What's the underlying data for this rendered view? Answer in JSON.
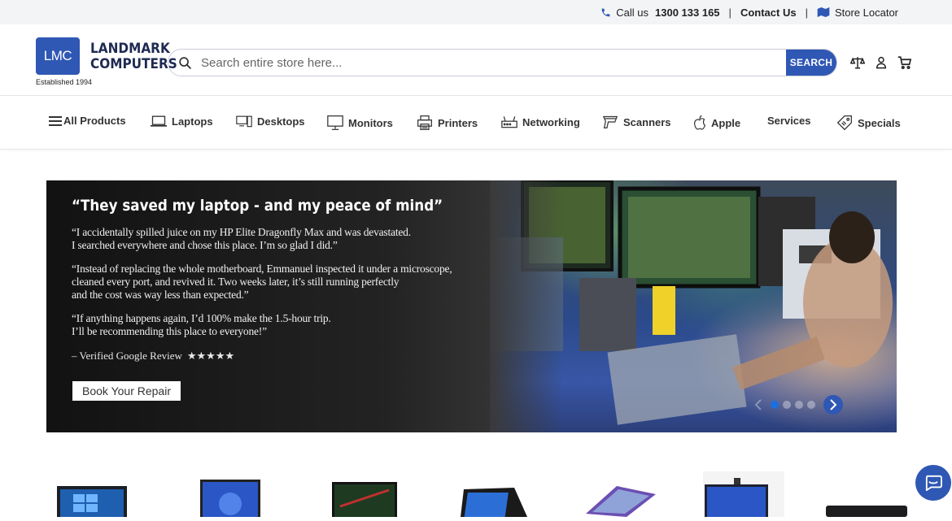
{
  "topbar": {
    "call_label": "Call us",
    "phone": "1300 133 165",
    "contact": "Contact Us",
    "store_locator": "Store Locator",
    "separator": "|"
  },
  "header": {
    "logo_initials": "LMC",
    "brand_line1": "LANDMARK",
    "brand_line2": "COMPUTERS",
    "established": "Established 1994",
    "search_placeholder": "Search entire store here...",
    "search_button": "SEARCH"
  },
  "nav": {
    "items": [
      {
        "label": "All Products",
        "icon": "menu-icon"
      },
      {
        "label": "Laptops",
        "icon": "laptop-icon"
      },
      {
        "label": "Desktops",
        "icon": "desktop-icon"
      },
      {
        "label": "Monitors",
        "icon": "monitor-icon"
      },
      {
        "label": "Printers",
        "icon": "printer-icon"
      },
      {
        "label": "Networking",
        "icon": "router-icon"
      },
      {
        "label": "Scanners",
        "icon": "scanner-icon"
      },
      {
        "label": "Apple",
        "icon": "apple-icon"
      },
      {
        "label": "Services",
        "icon": ""
      },
      {
        "label": "Specials",
        "icon": "tag-icon"
      }
    ]
  },
  "banner": {
    "headline": "“They saved my laptop - and my peace of mind”",
    "quote1": "“I accidentally spilled juice on my HP Elite Dragonfly Max and was devastated.\nI searched everywhere and chose this place. I’m so glad I did.”",
    "quote2": "“Instead of replacing the whole motherboard, Emmanuel inspected it under a microscope,\ncleaned every port, and revived it. Two weeks later, it’s still running perfectly\nand the cost was way less than expected.”",
    "quote3": "“If anything happens again, I’d 100% make the 1.5-hour trip.\nI’ll be recommending this place to everyone!”",
    "review_source": "– Verified Google Review",
    "stars": "★★★★★",
    "rating_stars": 5,
    "cta": "Book Your Repair",
    "slides_count": 4,
    "active_slide": 1
  },
  "colors": {
    "brand": "#2f57b4",
    "topbar_bg": "#f3f4f6",
    "dot_active": "#1c6fe0"
  }
}
